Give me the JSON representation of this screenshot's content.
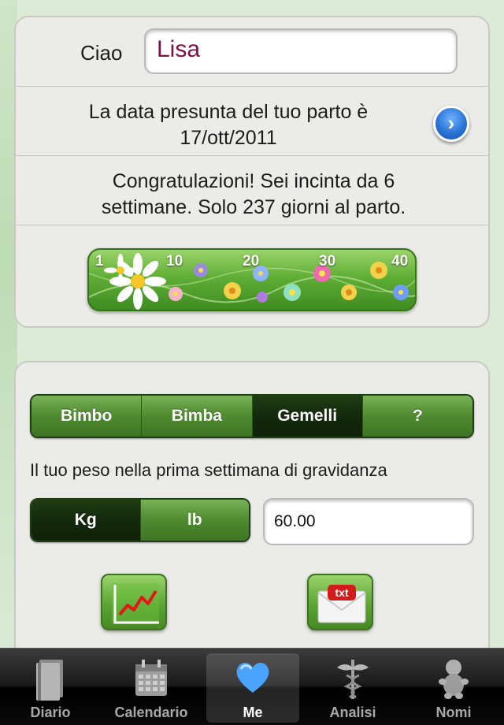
{
  "profile": {
    "greeting": "Ciao",
    "name": "Lisa",
    "due_date_label": "La data presunta del tuo parto è",
    "due_date": "17/ott/2011",
    "congrats_line1": "Congratulazioni! Sei incinta da 6",
    "congrats_line2": "settimane. Solo 237 giorni al parto.",
    "week_ticks": [
      "1",
      "10",
      "20",
      "30",
      "40"
    ]
  },
  "settings": {
    "gender_options": [
      "Bimbo",
      "Bimba",
      "Gemelli",
      "?"
    ],
    "gender_selected": "Gemelli",
    "weight_label": "Il tuo peso nella prima settimana di gravidanza",
    "unit_options": [
      "Kg",
      "lb"
    ],
    "unit_selected": "Kg",
    "weight_value": "60.00"
  },
  "tabbar": {
    "tabs": [
      {
        "label": "Diario",
        "icon": "book-icon"
      },
      {
        "label": "Calendario",
        "icon": "calendar-icon"
      },
      {
        "label": "Me",
        "icon": "heart-icon"
      },
      {
        "label": "Analisi",
        "icon": "caduceus-icon"
      },
      {
        "label": "Nomi",
        "icon": "baby-icon"
      }
    ],
    "active": "Me"
  },
  "colors": {
    "name_text": "#7a1047",
    "segment_green": "#4f8a30",
    "segment_selected": "#132a0b",
    "tab_active_icon": "#4aa3ff"
  }
}
